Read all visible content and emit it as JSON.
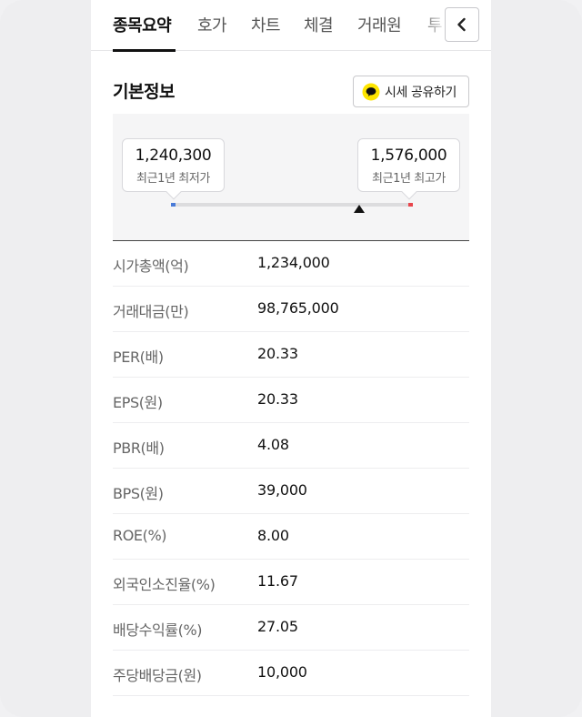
{
  "tabs": [
    {
      "label": "종목요약",
      "active": true
    },
    {
      "label": "호가",
      "active": false
    },
    {
      "label": "차트",
      "active": false
    },
    {
      "label": "체결",
      "active": false
    },
    {
      "label": "거래원",
      "active": false
    },
    {
      "label": "투",
      "active": false
    }
  ],
  "icons": {
    "back": "chevron-left-icon",
    "kakao": "kakao-talk-icon"
  },
  "section": {
    "title": "기본정보",
    "share_label": "시세 공유하기"
  },
  "range": {
    "low": {
      "value": "1,240,300",
      "caption": "최근1년 최저가"
    },
    "high": {
      "value": "1,576,000",
      "caption": "최근1년 최고가"
    },
    "current_position": 0.78,
    "colors": {
      "low": "#4a7bd8",
      "high": "#e8454c"
    }
  },
  "stats": [
    {
      "label": "시가총액(억)",
      "value": "1,234,000"
    },
    {
      "label": "거래대금(만)",
      "value": "98,765,000"
    },
    {
      "label": "PER(배)",
      "value": "20.33"
    },
    {
      "label": "EPS(원)",
      "value": "20.33"
    },
    {
      "label": "PBR(배)",
      "value": "4.08"
    },
    {
      "label": "BPS(원)",
      "value": "39,000"
    },
    {
      "label": "ROE(%)",
      "value": "8.00"
    },
    {
      "label": "외국인소진율(%)",
      "value": "11.67"
    },
    {
      "label": "배당수익률(%)",
      "value": "27.05"
    },
    {
      "label": "주당배당금(원)",
      "value": "10,000"
    }
  ]
}
